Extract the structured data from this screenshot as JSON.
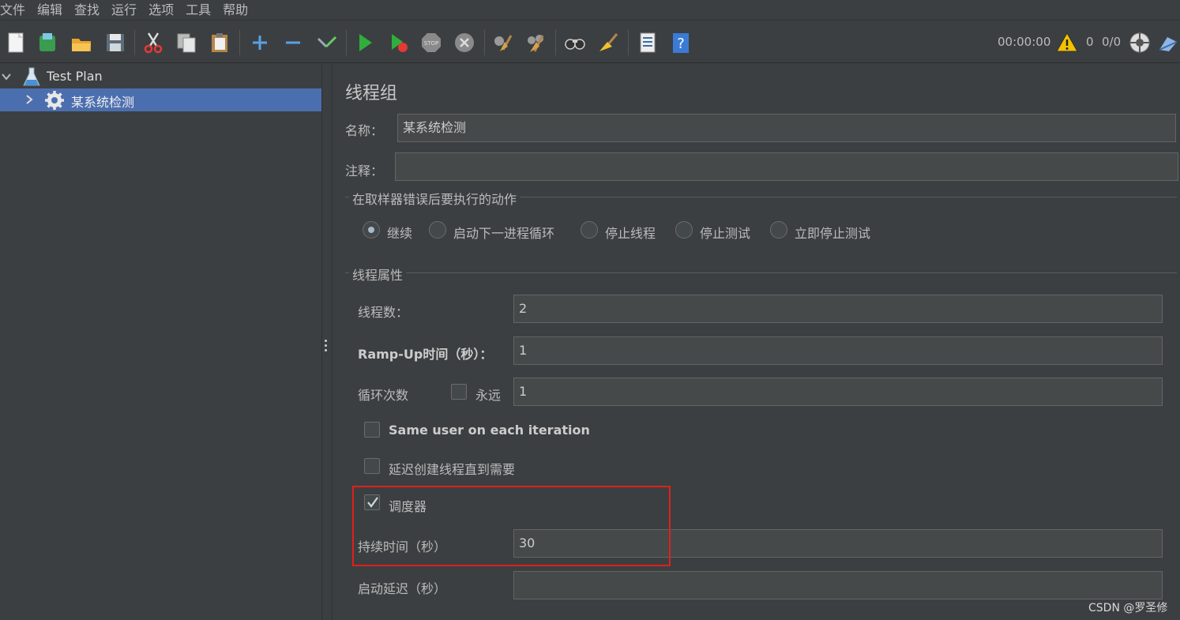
{
  "menu": [
    "文件",
    "编辑",
    "查找",
    "运行",
    "选项",
    "工具",
    "帮助"
  ],
  "toolbar": {
    "timer": "00:00:00",
    "warning_count": "0",
    "thread_count": "0/0"
  },
  "tree": {
    "root_label": "Test Plan",
    "child_label": "某系统检测"
  },
  "panel": {
    "title": "线程组",
    "name_label": "名称：",
    "name_value": "某系统检测",
    "comment_label": "注释：",
    "comment_value": "",
    "error_section_title": "在取样器错误后要执行的动作",
    "error_options": [
      "继续",
      "启动下一进程循环",
      "停止线程",
      "停止测试",
      "立即停止测试"
    ],
    "error_selected": "继续",
    "thread_section_title": "线程属性",
    "threads_label": "线程数：",
    "threads_value": "2",
    "rampup_label": "Ramp-Up时间（秒）：",
    "rampup_value": "1",
    "loop_label": "循环次数",
    "forever_label": "永远",
    "forever_checked": false,
    "loop_value": "1",
    "same_user_label": "Same user on each iteration",
    "same_user_checked": false,
    "delay_create_label": "延迟创建线程直到需要",
    "delay_create_checked": false,
    "scheduler_label": "调度器",
    "scheduler_checked": true,
    "duration_label": "持续时间（秒）",
    "duration_value": "30",
    "startup_delay_label": "启动延迟（秒）",
    "startup_delay_value": ""
  },
  "watermark": "CSDN @罗圣修",
  "colors": {
    "background": "#3c3f41",
    "selection": "#4b6eaf",
    "highlight": "#e0201b"
  }
}
